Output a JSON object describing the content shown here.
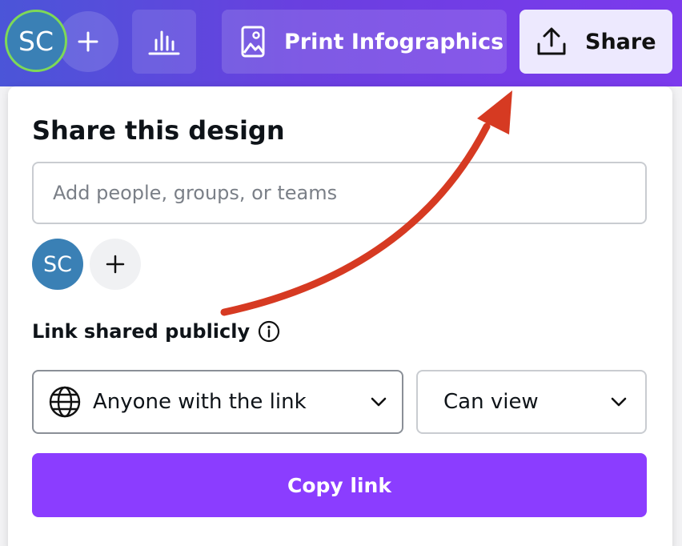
{
  "toolbar": {
    "avatar_initials": "SC",
    "add_icon": "plus-icon",
    "chart_icon": "bar-chart-icon",
    "print_label": "Print Infographics",
    "print_icon": "image-icon",
    "share_label": "Share",
    "share_icon": "upload-icon"
  },
  "share_panel": {
    "title": "Share this design",
    "people_input": {
      "placeholder": "Add people, groups, or teams",
      "value": ""
    },
    "collaborators": [
      {
        "initials": "SC"
      }
    ],
    "add_collaborator_icon": "plus-icon",
    "link_section_label": "Link shared publicly",
    "info_icon": "info-icon",
    "access_select": {
      "value": "Anyone with the link",
      "icon": "globe-icon"
    },
    "permission_select": {
      "value": "Can view"
    },
    "copy_button_label": "Copy link"
  },
  "colors": {
    "toolbar_gradient_start": "#4b55d8",
    "toolbar_gradient_end": "#7c3aed",
    "share_button_bg": "#ede9fe",
    "primary_button": "#8b3dff",
    "avatar_bg": "#3a80b5",
    "avatar_ring": "#7ed957",
    "annotation_arrow": "#d63a22"
  }
}
